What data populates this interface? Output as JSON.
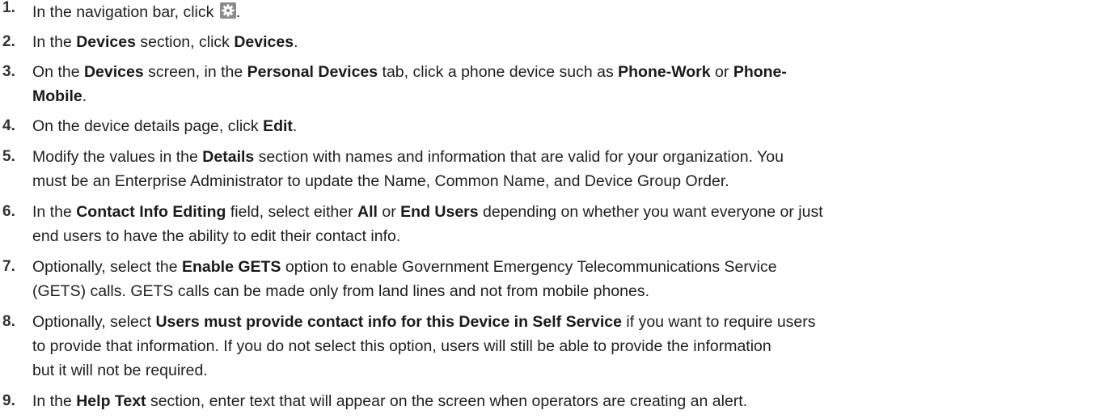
{
  "steps": [
    {
      "number": "1.",
      "parts": [
        {
          "t": "In the navigation bar, click "
        },
        {
          "icon": "gear-icon"
        },
        {
          "t": "."
        }
      ]
    },
    {
      "number": "2.",
      "parts": [
        {
          "t": "In the "
        },
        {
          "b": "Devices"
        },
        {
          "t": " section, click "
        },
        {
          "b": "Devices"
        },
        {
          "t": "."
        }
      ]
    },
    {
      "number": "3.",
      "parts": [
        {
          "t": "On the "
        },
        {
          "b": "Devices"
        },
        {
          "t": " screen, in the "
        },
        {
          "b": "Personal Devices"
        },
        {
          "t": " tab, click a phone device such as "
        },
        {
          "b": "Phone-Work"
        },
        {
          "t": " or "
        },
        {
          "b": "Phone-"
        },
        {
          "br": true
        },
        {
          "b": "Mobile"
        },
        {
          "t": "."
        }
      ]
    },
    {
      "number": "4.",
      "parts": [
        {
          "t": "On the device details page, click "
        },
        {
          "b": "Edit"
        },
        {
          "t": "."
        }
      ]
    },
    {
      "number": "5.",
      "parts": [
        {
          "t": "Modify the values in the "
        },
        {
          "b": "Details"
        },
        {
          "t": " section with names and information that are valid for your organization. You"
        },
        {
          "br": true
        },
        {
          "t": "must be an Enterprise Administrator to update the Name, Common Name, and Device Group Order."
        }
      ]
    },
    {
      "number": "6.",
      "parts": [
        {
          "t": "In the "
        },
        {
          "b": "Contact Info Editing"
        },
        {
          "t": " field, select either "
        },
        {
          "b": "All"
        },
        {
          "t": " or "
        },
        {
          "b": "End Users"
        },
        {
          "t": " depending on whether you want everyone or just"
        },
        {
          "br": true
        },
        {
          "t": "end users to have the ability to edit their contact info."
        }
      ]
    },
    {
      "number": "7.",
      "parts": [
        {
          "t": "Optionally, select the "
        },
        {
          "b": "Enable GETS"
        },
        {
          "t": " option to enable Government Emergency Telecommunications Service"
        },
        {
          "br": true
        },
        {
          "t": "(GETS) calls. GETS calls can be made only from land lines and not from mobile phones."
        }
      ]
    },
    {
      "number": "8.",
      "parts": [
        {
          "t": "Optionally, select "
        },
        {
          "b": "Users must provide contact info for this Device in Self Service"
        },
        {
          "t": " if you want to require users"
        },
        {
          "br": true
        },
        {
          "t": "to provide that information. If you do not select this option, users will still be able to provide the information"
        },
        {
          "br": true
        },
        {
          "t": "but it will not be required."
        }
      ]
    },
    {
      "number": "9.",
      "parts": [
        {
          "t": "In the "
        },
        {
          "b": "Help Text"
        },
        {
          "t": " section, enter text that will appear on the screen when operators are creating an alert."
        }
      ]
    }
  ],
  "icon_colors": {
    "gear_background": "#8a8a8a",
    "gear_foreground": "#ffffff"
  }
}
